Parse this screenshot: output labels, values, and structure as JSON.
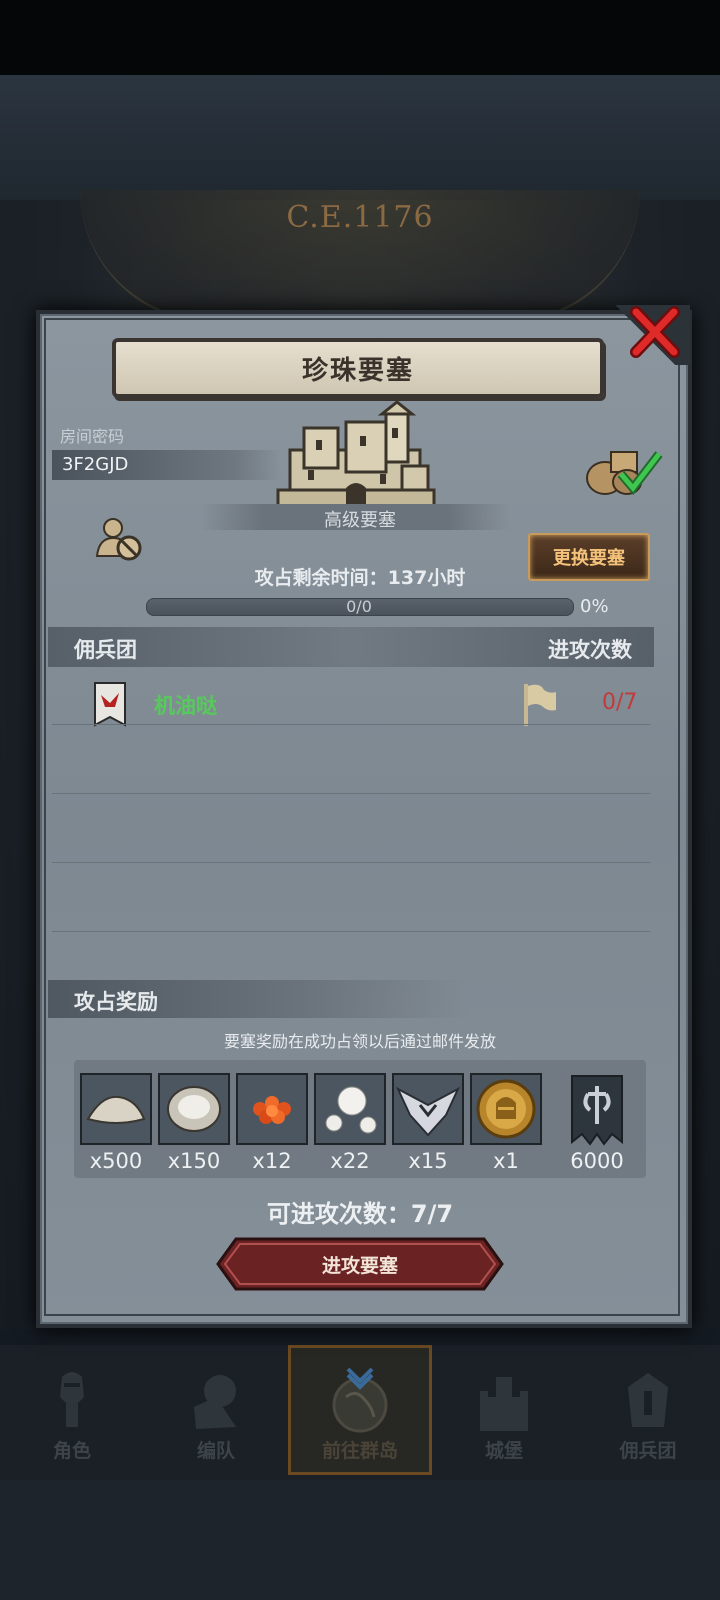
{
  "background": {
    "era_label": "C.E.1176"
  },
  "modal": {
    "title": "珍珠要塞",
    "room_code_label": "房间密码",
    "room_code": "3F2GJD",
    "fortress_type": "高级要塞",
    "change_button": "更换要塞",
    "time_remaining": "攻占剩余时间：137小时",
    "progress": {
      "text": "0/0",
      "percent_text": "0%",
      "fraction": 0
    },
    "mercenary_table": {
      "col_left": "佣兵团",
      "col_right": "进攻次数",
      "rows": [
        {
          "name": "机油哒",
          "attacks": "0/7"
        }
      ]
    },
    "rewards": {
      "header": "攻占奖励",
      "note": "要塞奖励在成功占领以后通过邮件发放",
      "items": [
        {
          "icon": "salt-icon",
          "qty": "x500"
        },
        {
          "icon": "oyster-icon",
          "qty": "x150"
        },
        {
          "icon": "roe-icon",
          "qty": "x12"
        },
        {
          "icon": "pearl-icon",
          "qty": "x22"
        },
        {
          "icon": "emblem-icon",
          "qty": "x15"
        },
        {
          "icon": "helmet-coin-icon",
          "qty": "x1"
        },
        {
          "icon": "guild-banner-icon",
          "qty": "6000"
        }
      ]
    },
    "attack_count": "可进攻次数：7/7",
    "attack_button": "进攻要塞"
  },
  "nav": [
    {
      "label": "角色",
      "icon": "knight-icon"
    },
    {
      "label": "编队",
      "icon": "formation-icon"
    },
    {
      "label": "前往群岛",
      "icon": "globe-icon",
      "active": true
    },
    {
      "label": "城堡",
      "icon": "castle-icon"
    },
    {
      "label": "佣兵团",
      "icon": "mercenary-icon"
    }
  ],
  "colors": {
    "accent_gold": "#f4c27a",
    "player_green": "#58c95d",
    "attack_red": "#c23a3a"
  }
}
